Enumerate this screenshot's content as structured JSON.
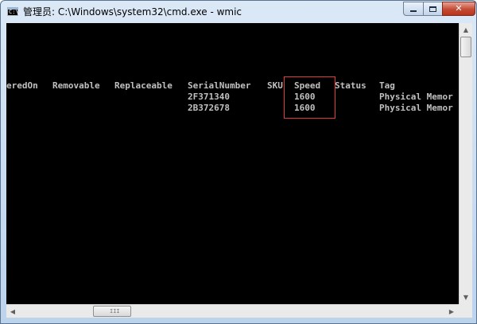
{
  "window": {
    "title": "管理员: C:\\Windows\\system32\\cmd.exe - wmic",
    "icon_text": "C:\\",
    "minimize_icon": "minimize-icon",
    "maximize_icon": "maximize-icon",
    "close_label": "✕"
  },
  "console": {
    "columns": [
      "eredOn",
      "Removable",
      "Replaceable",
      "SerialNumber",
      "SKU",
      "Speed",
      "Status",
      "Tag"
    ],
    "rows": [
      [
        "",
        "",
        "",
        "2F371340",
        "",
        "1600",
        "",
        "Physical Memor"
      ],
      [
        "",
        "",
        "",
        "2B372678",
        "",
        "1600",
        "",
        "Physical Memor"
      ]
    ],
    "highlight_color": "#e23b3b"
  },
  "scrollbar": {
    "up_arrow": "▲",
    "down_arrow": "▼",
    "left_arrow": "◀",
    "right_arrow": "▶",
    "grip": "III"
  }
}
